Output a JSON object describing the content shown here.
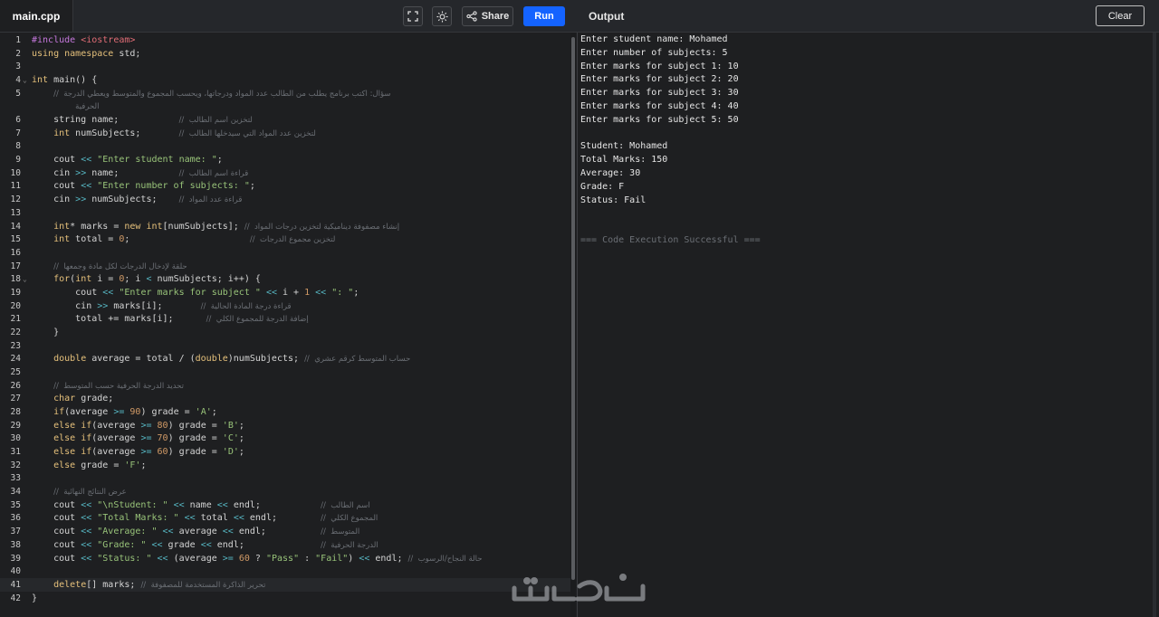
{
  "file_tab": "main.cpp",
  "toolbar": {
    "share_label": "Share",
    "run_label": "Run",
    "output_title": "Output",
    "clear_label": "Clear"
  },
  "code_lines": [
    {
      "n": "1",
      "html": "<span class=\"inc\">#include</span> <span class=\"ang\">&lt;iostream&gt;</span>"
    },
    {
      "n": "2",
      "html": "<span class=\"kw\">using</span> <span class=\"kw\">namespace</span> std;"
    },
    {
      "n": "3",
      "html": ""
    },
    {
      "n": "4",
      "fold": true,
      "html": "<span class=\"kw\">int</span> main() {"
    },
    {
      "n": "5",
      "html": "    <span class=\"cm\">//  سؤال: اكتب برنامج يطلب من الطالب عدد المواد ودرجاتها، ويحسب المجموع والمتوسط ويعطي الدرجة</span>"
    },
    {
      "n": "",
      "html": "        <span class=\"cm\">الحرفية</span>"
    },
    {
      "n": "6",
      "html": "    string name;           <span class=\"cm\">//  لتخزين اسم الطالب</span>"
    },
    {
      "n": "7",
      "html": "    <span class=\"kw\">int</span> numSubjects;       <span class=\"cm\">//  لتخزين عدد المواد التي سيدخلها الطالب</span>"
    },
    {
      "n": "8",
      "html": ""
    },
    {
      "n": "9",
      "html": "    cout <span class=\"op\">&lt;&lt;</span> <span class=\"str\">\"Enter student name: \"</span>;"
    },
    {
      "n": "10",
      "html": "    cin <span class=\"op\">&gt;&gt;</span> name;           <span class=\"cm\">//  قراءة اسم الطالب</span>"
    },
    {
      "n": "11",
      "html": "    cout <span class=\"op\">&lt;&lt;</span> <span class=\"str\">\"Enter number of subjects: \"</span>;"
    },
    {
      "n": "12",
      "html": "    cin <span class=\"op\">&gt;&gt;</span> numSubjects;    <span class=\"cm\">//  قراءة عدد المواد</span>"
    },
    {
      "n": "13",
      "html": ""
    },
    {
      "n": "14",
      "html": "    <span class=\"kw\">int</span>* marks = <span class=\"kw\">new</span> <span class=\"kw\">int</span>[numSubjects]; <span class=\"cm\">//  إنشاء مصفوفة ديناميكية لتخزين درجات المواد</span>"
    },
    {
      "n": "15",
      "html": "    <span class=\"kw\">int</span> total = <span class=\"num\">0</span>;                      <span class=\"cm\">//  لتخزين مجموع الدرجات</span>"
    },
    {
      "n": "16",
      "html": ""
    },
    {
      "n": "17",
      "html": "    <span class=\"cm\">//  حلقة لإدخال الدرجات لكل مادة وجمعها</span>"
    },
    {
      "n": "18",
      "fold": true,
      "html": "    <span class=\"kw\">for</span>(<span class=\"kw\">int</span> i = <span class=\"num\">0</span>; i <span class=\"op\">&lt;</span> numSubjects; i++) {"
    },
    {
      "n": "19",
      "html": "        cout <span class=\"op\">&lt;&lt;</span> <span class=\"str\">\"Enter marks for subject \"</span> <span class=\"op\">&lt;&lt;</span> i + <span class=\"num\">1</span> <span class=\"op\">&lt;&lt;</span> <span class=\"str\">\": \"</span>;"
    },
    {
      "n": "20",
      "html": "        cin <span class=\"op\">&gt;&gt;</span> marks[i];       <span class=\"cm\">//  قراءة درجة المادة الحالية</span>"
    },
    {
      "n": "21",
      "html": "        total += marks[i];      <span class=\"cm\">//  إضافة الدرجة للمجموع الكلي</span>"
    },
    {
      "n": "22",
      "html": "    }"
    },
    {
      "n": "23",
      "html": ""
    },
    {
      "n": "24",
      "html": "    <span class=\"kw\">double</span> average = total / (<span class=\"kw\">double</span>)numSubjects; <span class=\"cm\">//  حساب المتوسط كرقم عشري</span>"
    },
    {
      "n": "25",
      "html": ""
    },
    {
      "n": "26",
      "html": "    <span class=\"cm\">//  تحديد الدرجة الحرفية حسب المتوسط</span>"
    },
    {
      "n": "27",
      "html": "    <span class=\"kw\">char</span> grade;"
    },
    {
      "n": "28",
      "html": "    <span class=\"kw\">if</span>(average <span class=\"op\">&gt;=</span> <span class=\"num\">90</span>) grade = <span class=\"str\">'A'</span>;"
    },
    {
      "n": "29",
      "html": "    <span class=\"kw\">else</span> <span class=\"kw\">if</span>(average <span class=\"op\">&gt;=</span> <span class=\"num\">80</span>) grade = <span class=\"str\">'B'</span>;"
    },
    {
      "n": "30",
      "html": "    <span class=\"kw\">else</span> <span class=\"kw\">if</span>(average <span class=\"op\">&gt;=</span> <span class=\"num\">70</span>) grade = <span class=\"str\">'C'</span>;"
    },
    {
      "n": "31",
      "html": "    <span class=\"kw\">else</span> <span class=\"kw\">if</span>(average <span class=\"op\">&gt;=</span> <span class=\"num\">60</span>) grade = <span class=\"str\">'D'</span>;"
    },
    {
      "n": "32",
      "html": "    <span class=\"kw\">else</span> grade = <span class=\"str\">'F'</span>;"
    },
    {
      "n": "33",
      "html": ""
    },
    {
      "n": "34",
      "html": "    <span class=\"cm\">//  عرض النتائج النهائية</span>"
    },
    {
      "n": "35",
      "html": "    cout <span class=\"op\">&lt;&lt;</span> <span class=\"str\">\"\\nStudent: \"</span> <span class=\"op\">&lt;&lt;</span> name <span class=\"op\">&lt;&lt;</span> endl;           <span class=\"cm\">//  اسم الطالب</span>"
    },
    {
      "n": "36",
      "html": "    cout <span class=\"op\">&lt;&lt;</span> <span class=\"str\">\"Total Marks: \"</span> <span class=\"op\">&lt;&lt;</span> total <span class=\"op\">&lt;&lt;</span> endl;        <span class=\"cm\">//  المجموع الكلي</span>"
    },
    {
      "n": "37",
      "html": "    cout <span class=\"op\">&lt;&lt;</span> <span class=\"str\">\"Average: \"</span> <span class=\"op\">&lt;&lt;</span> average <span class=\"op\">&lt;&lt;</span> endl;          <span class=\"cm\">//  المتوسط</span>"
    },
    {
      "n": "38",
      "html": "    cout <span class=\"op\">&lt;&lt;</span> <span class=\"str\">\"Grade: \"</span> <span class=\"op\">&lt;&lt;</span> grade <span class=\"op\">&lt;&lt;</span> endl;              <span class=\"cm\">//  الدرجة الحرفية</span>"
    },
    {
      "n": "39",
      "html": "    cout <span class=\"op\">&lt;&lt;</span> <span class=\"str\">\"Status: \"</span> <span class=\"op\">&lt;&lt;</span> (average <span class=\"op\">&gt;=</span> <span class=\"num\">60</span> ? <span class=\"str\">\"Pass\"</span> : <span class=\"str\">\"Fail\"</span>) <span class=\"op\">&lt;&lt;</span> endl; <span class=\"cm\">//  حالة النجاح/الرسوب</span>"
    },
    {
      "n": "40",
      "html": ""
    },
    {
      "n": "41",
      "active": true,
      "html": "    <span class=\"kw\">delete</span>[] marks; <span class=\"cm\">//  تحرير الذاكرة المستخدمة للمصفوفة</span>"
    },
    {
      "n": "42",
      "html": "}"
    }
  ],
  "output_lines": [
    "Enter student name: Mohamed",
    "Enter number of subjects: 5",
    "Enter marks for subject 1: 10",
    "Enter marks for subject 2: 20",
    "Enter marks for subject 3: 30",
    "Enter marks for subject 4: 40",
    "Enter marks for subject 5: 50",
    "",
    "Student: Mohamed",
    "Total Marks: 150",
    "Average: 30",
    "Grade: F",
    "Status: Fail",
    "",
    "",
    "=== Code Execution Successful ==="
  ],
  "watermark": "خمسات"
}
